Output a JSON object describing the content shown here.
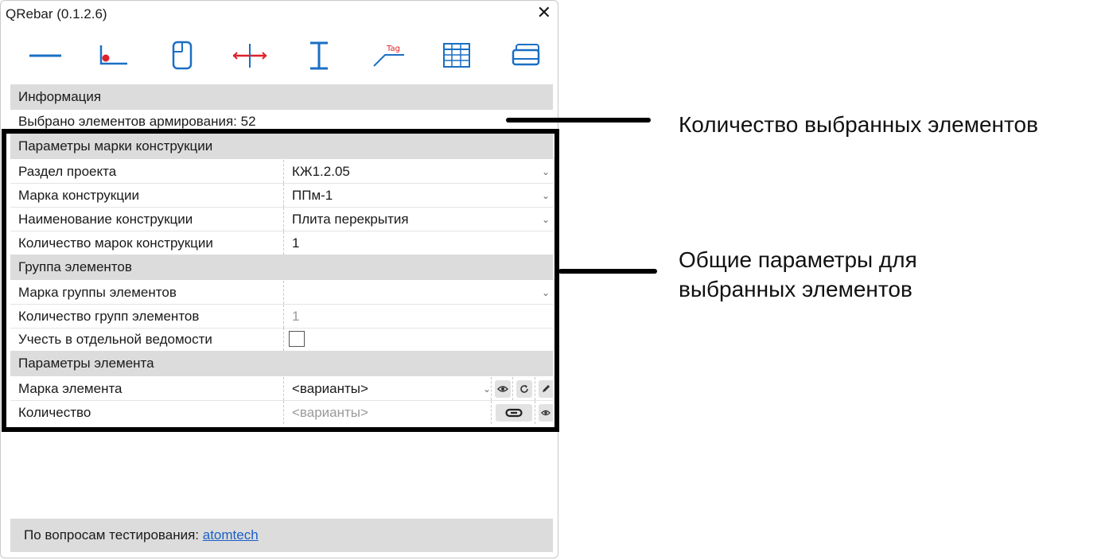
{
  "window": {
    "title": "QRebar (0.1.2.6)",
    "close_glyph": "✕"
  },
  "toolbar": {
    "buttons": [
      {
        "icon": "line-rebar-icon",
        "color": "#1a6fc4"
      },
      {
        "icon": "shape-corner-icon",
        "color": "#e0202a"
      },
      {
        "icon": "mouse-select-icon",
        "color": "#1a6fc4"
      },
      {
        "icon": "cross-section-icon",
        "color": "#e0202a"
      },
      {
        "icon": "dimension-icon",
        "color": "#1a6fc4"
      },
      {
        "icon": "tag-icon",
        "color": "#e0202a"
      },
      {
        "icon": "schedule-table-icon",
        "color": "#1a6fc4"
      },
      {
        "icon": "layers-stack-icon",
        "color": "#1a6fc4"
      }
    ],
    "tag_icon_text": "Tag"
  },
  "info": {
    "header": "Информация",
    "selected_line": "Выбрано элементов армирования: 52"
  },
  "structure_params": {
    "header": "Параметры марки конструкции",
    "rows": [
      {
        "label": "Раздел проекта",
        "value": "КЖ1.2.05",
        "dropdown": true
      },
      {
        "label": "Марка конструкции",
        "value": "ППм-1",
        "dropdown": true
      },
      {
        "label": "Наименование конструкции",
        "value": "Плита перекрытия",
        "dropdown": true
      },
      {
        "label": "Количество марок конструкции",
        "value": "1",
        "dropdown": false
      }
    ]
  },
  "element_group": {
    "header": "Группа элементов",
    "mark_label": "Марка группы элементов",
    "mark_value": "",
    "count_label": "Количество групп элементов",
    "count_value": "1",
    "separate_label": "Учесть в отдельной ведомости",
    "separate_checked": false
  },
  "element_params": {
    "header": "Параметры элемента",
    "mark_label": "Марка элемента",
    "mark_value": "<варианты>",
    "count_label": "Количество",
    "count_value": "<варианты>"
  },
  "footer": {
    "text": "По вопросам тестирования: ",
    "link": "atomtech"
  },
  "annotations": {
    "selected_count": "Количество выбранных элементов",
    "common_params_line1": "Общие параметры для",
    "common_params_line2": "выбранных элементов"
  },
  "dropdown_glyph": "⌄"
}
